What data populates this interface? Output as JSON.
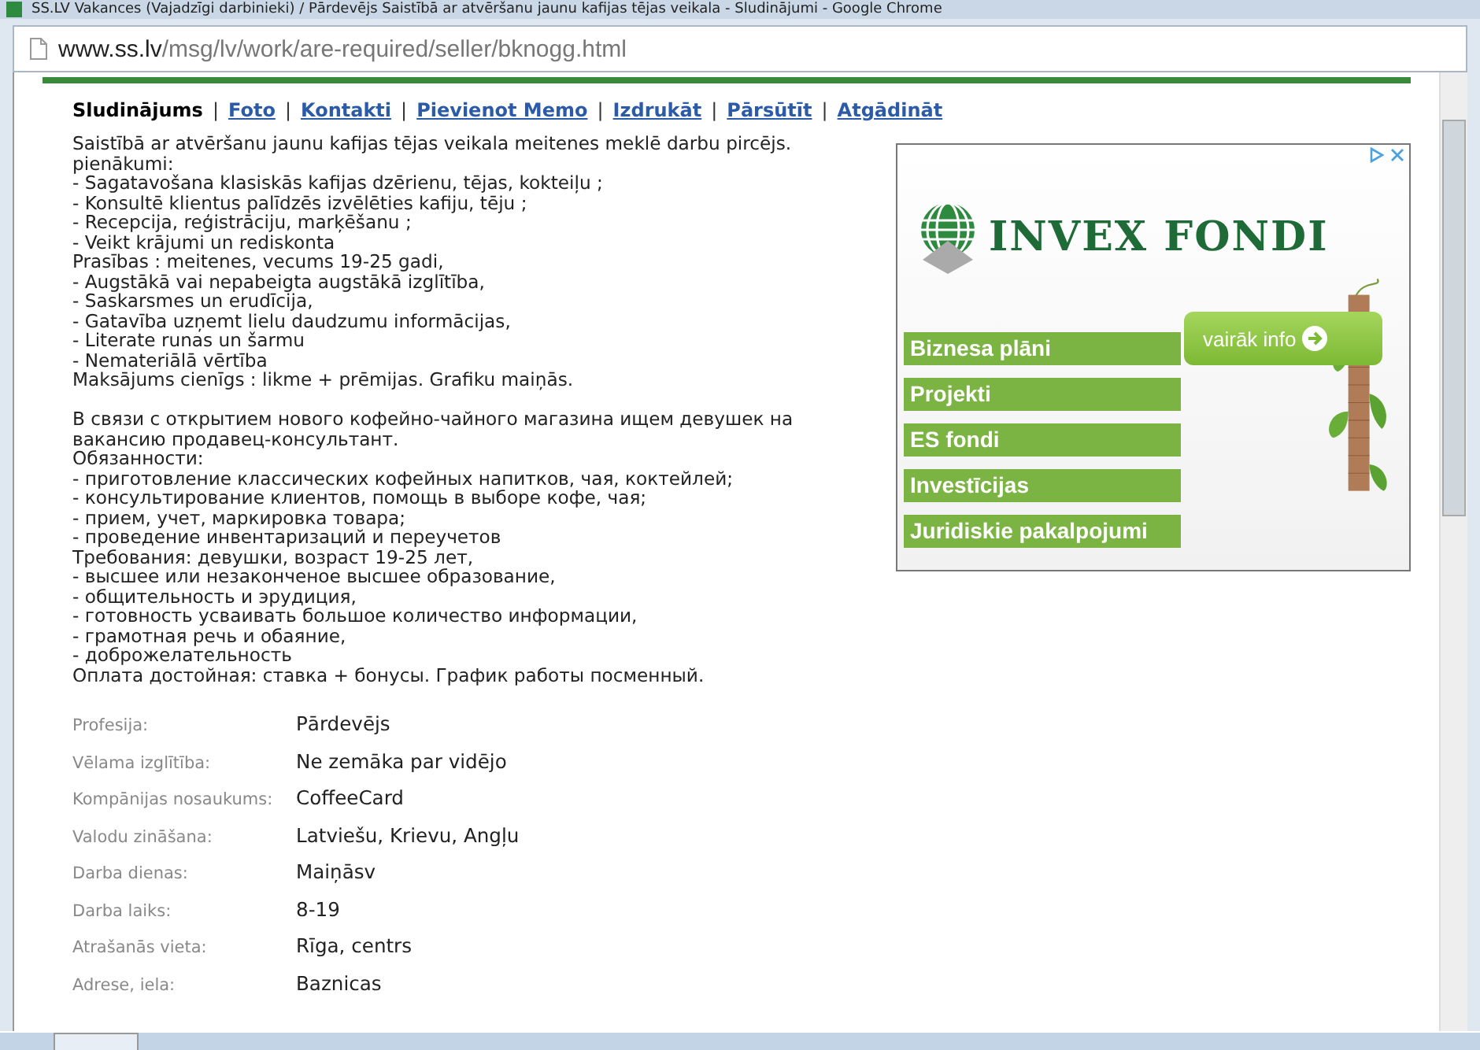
{
  "window": {
    "title": "SS.LV Vakances (Vajadzīgi darbinieki) / Pārdevējs Saistībā ar atvēršanu jaunu kafijas tējas veikala - Sludinājumi - Google Chrome"
  },
  "address_bar": {
    "host": "www.ss.lv",
    "path": "/msg/lv/work/are-required/seller/bknogg.html"
  },
  "nav": [
    {
      "label": "Sludinājums",
      "selected": true
    },
    {
      "label": "Foto",
      "selected": false
    },
    {
      "label": "Kontakti",
      "selected": false
    },
    {
      "label": "Pievienot Memo",
      "selected": false
    },
    {
      "label": "Izdrukāt",
      "selected": false
    },
    {
      "label": "Pārsūtīt",
      "selected": false
    },
    {
      "label": "Atgādināt",
      "selected": false
    }
  ],
  "separator": "|",
  "description_lv": [
    "Saistībā ar atvēršanu jaunu kafijas tējas veikala meitenes meklē darbu pircējs.",
    "pienākumi:",
    "- Sagatavošana klasiskās kafijas dzērienu, tējas, kokteiļu ;",
    "- Konsultē klientus palīdzēs izvēlēties kafiju, tēju ;",
    "- Recepcija, reģistrāciju, marķēšanu ;",
    "- Veikt krājumi un rediskonta",
    "Prasības : meitenes, vecums 19-25 gadi,",
    "- Augstākā vai nepabeigta augstākā izglītība,",
    "- Saskarsmes un erudīcija,",
    "- Gatavība uzņemt lielu daudzumu informācijas,",
    "- Literate runas un šarmu",
    "- Nemateriālā vērtība",
    "Maksājums cienīgs : likme + prēmijas. Grafiku maiņās."
  ],
  "description_ru": [
    "В связи с открытием нового кофейно-чайного магазина ищем девушек на",
    "вакансию продавец-консультант.",
    "Обязанности:",
    "- приготовление классических кофейных напитков, чая, коктейлей;",
    "- консультирование клиентов, помощь в выборе кофе, чая;",
    "- прием, учет, маркировка товара;",
    "- проведение инвентаризаций и переучетов",
    "Требования: девушки, возраст 19-25 лет,",
    "- высшее или незаконченое высшее образование,",
    "- общительность и эрудиция,",
    "- готовность усваивать большое количество информации,",
    "- грамотная речь и обаяние,",
    "- доброжелательность",
    "Оплата достойная: ставка + бонусы. График работы посменный."
  ],
  "details": [
    {
      "label": "Profesija:",
      "value": "Pārdevējs"
    },
    {
      "label": "Vēlama izglītība:",
      "value": "Ne zemāka par vidējo"
    },
    {
      "label": "Kompānijas nosaukums:",
      "value": "CoffeeCard"
    },
    {
      "label": "Valodu zināšana:",
      "value": "Latviešu, Krievu, Angļu"
    },
    {
      "label": "Darba dienas:",
      "value": "Maiņāsv"
    },
    {
      "label": "Darba laiks:",
      "value": "8-19"
    },
    {
      "label": "Atrašanās vieta:",
      "value": "Rīga, centrs"
    },
    {
      "label": "Adrese, iela:",
      "value": "Baznicas"
    }
  ],
  "ad": {
    "logo_text": "INVEX FONDI",
    "button": "vairāk info",
    "menu": [
      "Biznesa plāni",
      "Projekti",
      "ES fondi",
      "Investīcijas",
      "Juridiskie pakalpojumi"
    ]
  }
}
